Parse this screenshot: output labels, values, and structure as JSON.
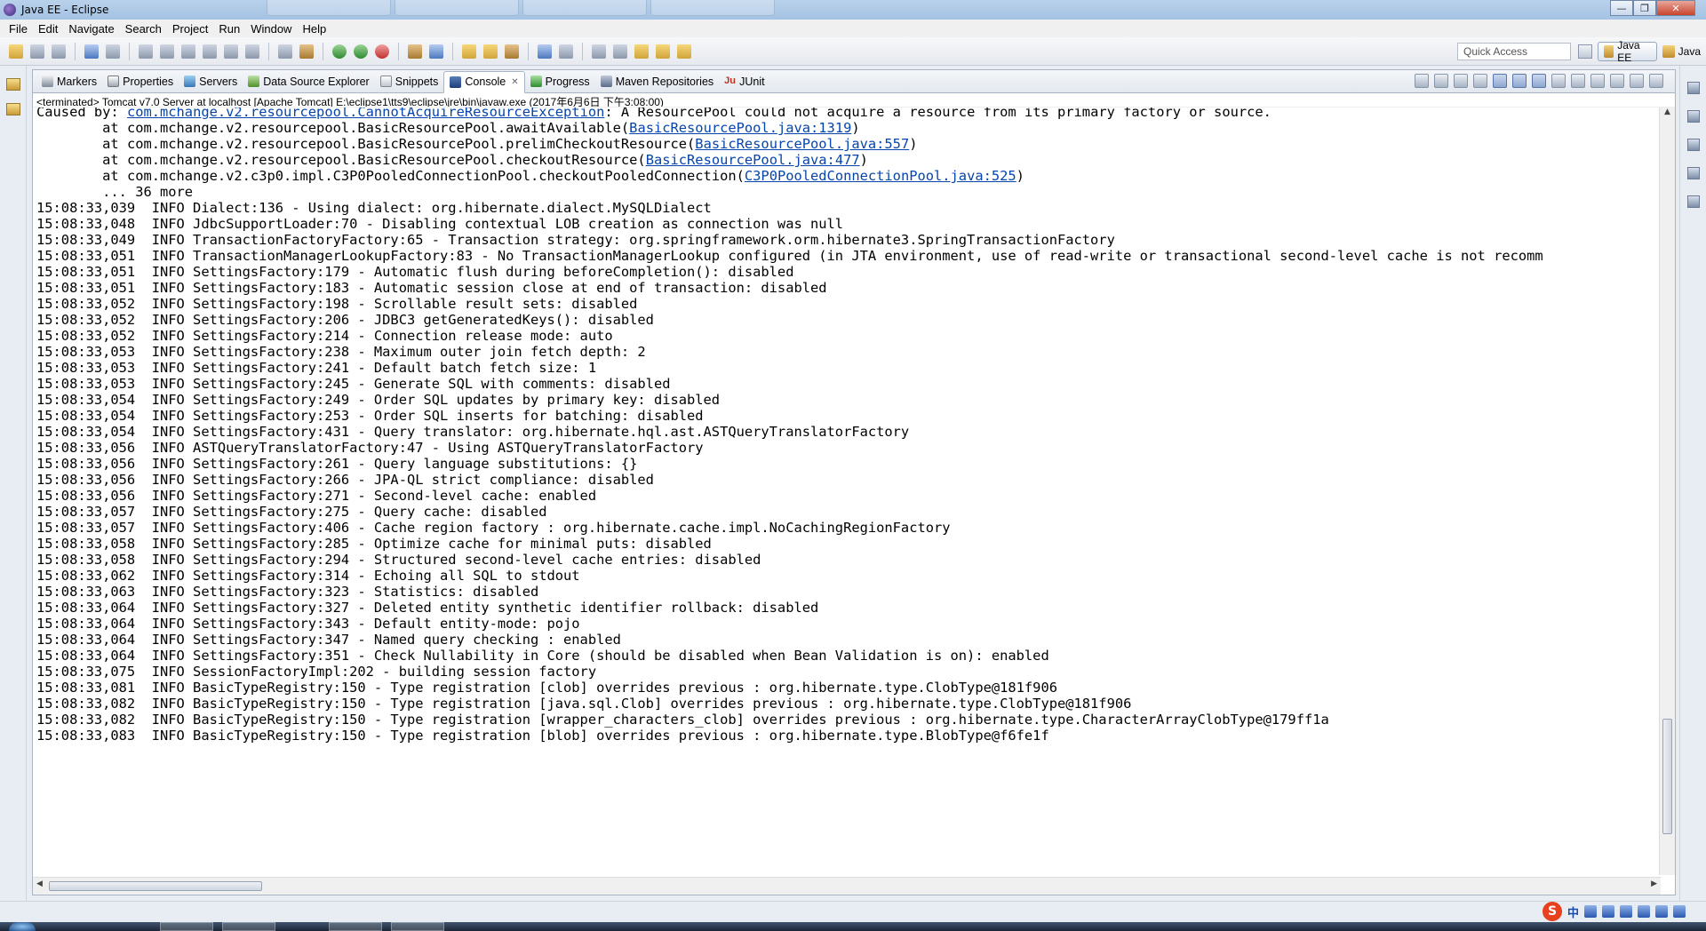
{
  "window": {
    "title": "Java EE - Eclipse",
    "controls": {
      "minimize": "—",
      "maximize": "❐",
      "close": "✕"
    }
  },
  "menu": [
    "File",
    "Edit",
    "Navigate",
    "Search",
    "Project",
    "Run",
    "Window",
    "Help"
  ],
  "toolbar": {
    "quick_access_placeholder": "Quick Access",
    "perspectives": [
      {
        "label": "Java EE",
        "active": true
      },
      {
        "label": "Java",
        "active": false
      }
    ]
  },
  "view_tabs": [
    {
      "label": "Markers",
      "icon": "markers-icon"
    },
    {
      "label": "Properties",
      "icon": "properties-icon"
    },
    {
      "label": "Servers",
      "icon": "servers-icon"
    },
    {
      "label": "Data Source Explorer",
      "icon": "data-source-icon"
    },
    {
      "label": "Snippets",
      "icon": "snippets-icon"
    },
    {
      "label": "Console",
      "icon": "console-icon",
      "active": true,
      "close": "✕"
    },
    {
      "label": "Progress",
      "icon": "progress-icon"
    },
    {
      "label": "Maven Repositories",
      "icon": "maven-icon"
    },
    {
      "label": "JUnit",
      "icon": "junit-icon",
      "icon_text": "Ju"
    }
  ],
  "console": {
    "process": "<terminated> Tomcat v7.0 Server at localhost [Apache Tomcat] E:\\eclipse1\\tts9\\eclipse\\jre\\bin\\javaw.exe (2017年6月6日 下午3:08:00)",
    "lines": [
      {
        "pre": "Caused by: ",
        "link": "com.mchange.v2.resourcepool.CannotAcquireResourceException",
        "post": ": A ResourcePool could not acquire a resource from its primary factory or source."
      },
      {
        "pre": "\tat com.mchange.v2.resourcepool.BasicResourcePool.awaitAvailable(",
        "link": "BasicResourcePool.java:1319",
        "post": ")"
      },
      {
        "pre": "\tat com.mchange.v2.resourcepool.BasicResourcePool.prelimCheckoutResource(",
        "link": "BasicResourcePool.java:557",
        "post": ")"
      },
      {
        "pre": "\tat com.mchange.v2.resourcepool.BasicResourcePool.checkoutResource(",
        "link": "BasicResourcePool.java:477",
        "post": ")"
      },
      {
        "pre": "\tat com.mchange.v2.c3p0.impl.C3P0PooledConnectionPool.checkoutPooledConnection(",
        "link": "C3P0PooledConnectionPool.java:525",
        "post": ")"
      },
      {
        "pre": "\t... 36 more"
      },
      {
        "pre": "15:08:33,039  INFO Dialect:136 - Using dialect: org.hibernate.dialect.MySQLDialect"
      },
      {
        "pre": "15:08:33,048  INFO JdbcSupportLoader:70 - Disabling contextual LOB creation as connection was null"
      },
      {
        "pre": "15:08:33,049  INFO TransactionFactoryFactory:65 - Transaction strategy: org.springframework.orm.hibernate3.SpringTransactionFactory"
      },
      {
        "pre": "15:08:33,051  INFO TransactionManagerLookupFactory:83 - No TransactionManagerLookup configured (in JTA environment, use of read-write or transactional second-level cache is not recomm"
      },
      {
        "pre": "15:08:33,051  INFO SettingsFactory:179 - Automatic flush during beforeCompletion(): disabled"
      },
      {
        "pre": "15:08:33,051  INFO SettingsFactory:183 - Automatic session close at end of transaction: disabled"
      },
      {
        "pre": "15:08:33,052  INFO SettingsFactory:198 - Scrollable result sets: disabled"
      },
      {
        "pre": "15:08:33,052  INFO SettingsFactory:206 - JDBC3 getGeneratedKeys(): disabled"
      },
      {
        "pre": "15:08:33,052  INFO SettingsFactory:214 - Connection release mode: auto"
      },
      {
        "pre": "15:08:33,053  INFO SettingsFactory:238 - Maximum outer join fetch depth: 2"
      },
      {
        "pre": "15:08:33,053  INFO SettingsFactory:241 - Default batch fetch size: 1"
      },
      {
        "pre": "15:08:33,053  INFO SettingsFactory:245 - Generate SQL with comments: disabled"
      },
      {
        "pre": "15:08:33,054  INFO SettingsFactory:249 - Order SQL updates by primary key: disabled"
      },
      {
        "pre": "15:08:33,054  INFO SettingsFactory:253 - Order SQL inserts for batching: disabled"
      },
      {
        "pre": "15:08:33,054  INFO SettingsFactory:431 - Query translator: org.hibernate.hql.ast.ASTQueryTranslatorFactory"
      },
      {
        "pre": "15:08:33,056  INFO ASTQueryTranslatorFactory:47 - Using ASTQueryTranslatorFactory"
      },
      {
        "pre": "15:08:33,056  INFO SettingsFactory:261 - Query language substitutions: {}"
      },
      {
        "pre": "15:08:33,056  INFO SettingsFactory:266 - JPA-QL strict compliance: disabled"
      },
      {
        "pre": "15:08:33,056  INFO SettingsFactory:271 - Second-level cache: enabled"
      },
      {
        "pre": "15:08:33,057  INFO SettingsFactory:275 - Query cache: disabled"
      },
      {
        "pre": "15:08:33,057  INFO SettingsFactory:406 - Cache region factory : org.hibernate.cache.impl.NoCachingRegionFactory"
      },
      {
        "pre": "15:08:33,058  INFO SettingsFactory:285 - Optimize cache for minimal puts: disabled"
      },
      {
        "pre": "15:08:33,058  INFO SettingsFactory:294 - Structured second-level cache entries: disabled"
      },
      {
        "pre": "15:08:33,062  INFO SettingsFactory:314 - Echoing all SQL to stdout"
      },
      {
        "pre": "15:08:33,063  INFO SettingsFactory:323 - Statistics: disabled"
      },
      {
        "pre": "15:08:33,064  INFO SettingsFactory:327 - Deleted entity synthetic identifier rollback: disabled"
      },
      {
        "pre": "15:08:33,064  INFO SettingsFactory:343 - Default entity-mode: pojo"
      },
      {
        "pre": "15:08:33,064  INFO SettingsFactory:347 - Named query checking : enabled"
      },
      {
        "pre": "15:08:33,064  INFO SettingsFactory:351 - Check Nullability in Core (should be disabled when Bean Validation is on): enabled"
      },
      {
        "pre": "15:08:33,075  INFO SessionFactoryImpl:202 - building session factory"
      },
      {
        "pre": "15:08:33,081  INFO BasicTypeRegistry:150 - Type registration [clob] overrides previous : org.hibernate.type.ClobType@181f906"
      },
      {
        "pre": "15:08:33,082  INFO BasicTypeRegistry:150 - Type registration [java.sql.Clob] overrides previous : org.hibernate.type.ClobType@181f906"
      },
      {
        "pre": "15:08:33,082  INFO BasicTypeRegistry:150 - Type registration [wrapper_characters_clob] overrides previous : org.hibernate.type.CharacterArrayClobType@179ff1a"
      },
      {
        "pre": "15:08:33,083  INFO BasicTypeRegistry:150 - Type registration [blob] overrides previous : org.hibernate.type.BlobType@f6fe1f"
      }
    ]
  },
  "ime": {
    "logo": "S",
    "mode": "中"
  },
  "colors": {
    "link": "#0645ad",
    "titlebar": "#b9d1ea",
    "background": "#e8ecf3"
  }
}
